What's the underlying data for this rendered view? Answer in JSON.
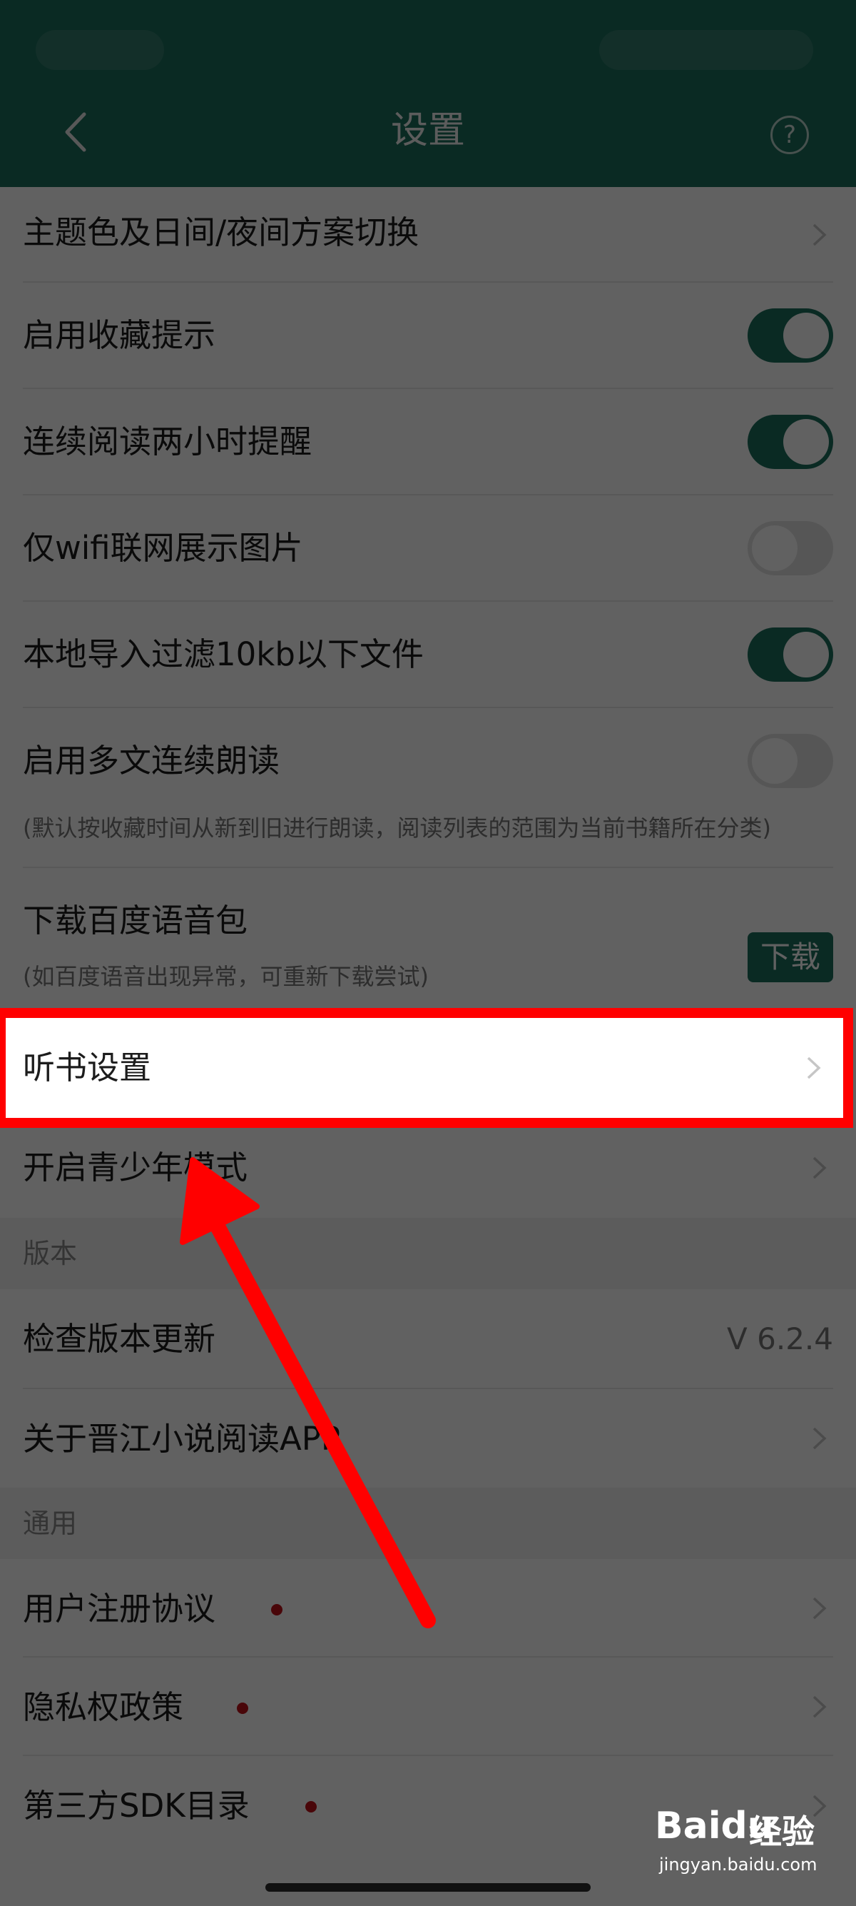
{
  "header": {
    "title": "设置",
    "help_glyph": "?"
  },
  "settings": {
    "theme_label": "主题色及日间/夜间方案切换",
    "favorite_tip_label": "启用收藏提示",
    "favorite_tip_on": true,
    "continuous_reminder_label": "连续阅读两小时提醒",
    "continuous_reminder_on": true,
    "wifi_images_label": "仅wifi联网展示图片",
    "wifi_images_on": false,
    "filter_import_label": "本地导入过滤10kb以下文件",
    "filter_import_on": true,
    "multi_read_label": "启用多文连续朗读",
    "multi_read_on": false,
    "multi_read_sub": "(默认按收藏时间从新到旧进行朗读，阅读列表的范围为当前书籍所在分类)",
    "baidu_voice_label": "下载百度语音包",
    "baidu_voice_sub": "(如百度语音出现异常，可重新下载尝试)",
    "download_button": "下载",
    "listen_settings_label": "听书设置",
    "teen_mode_label": "开启青少年模式"
  },
  "version_section": {
    "header": "版本",
    "check_update_label": "检查版本更新",
    "version_value": "V 6.2.4",
    "about_label": "关于晋江小说阅读APP"
  },
  "general_section": {
    "header": "通用",
    "user_agreement_label": "用户注册协议",
    "privacy_label": "隐私权政策",
    "sdk_label": "第三方SDK目录"
  },
  "watermark": {
    "brand": "Baidu",
    "jingyan": "经验",
    "url": "jingyan.baidu.com"
  },
  "colors": {
    "accent": "#1b6e5c",
    "highlight_border": "#ff0000",
    "dot": "#c0101a"
  }
}
